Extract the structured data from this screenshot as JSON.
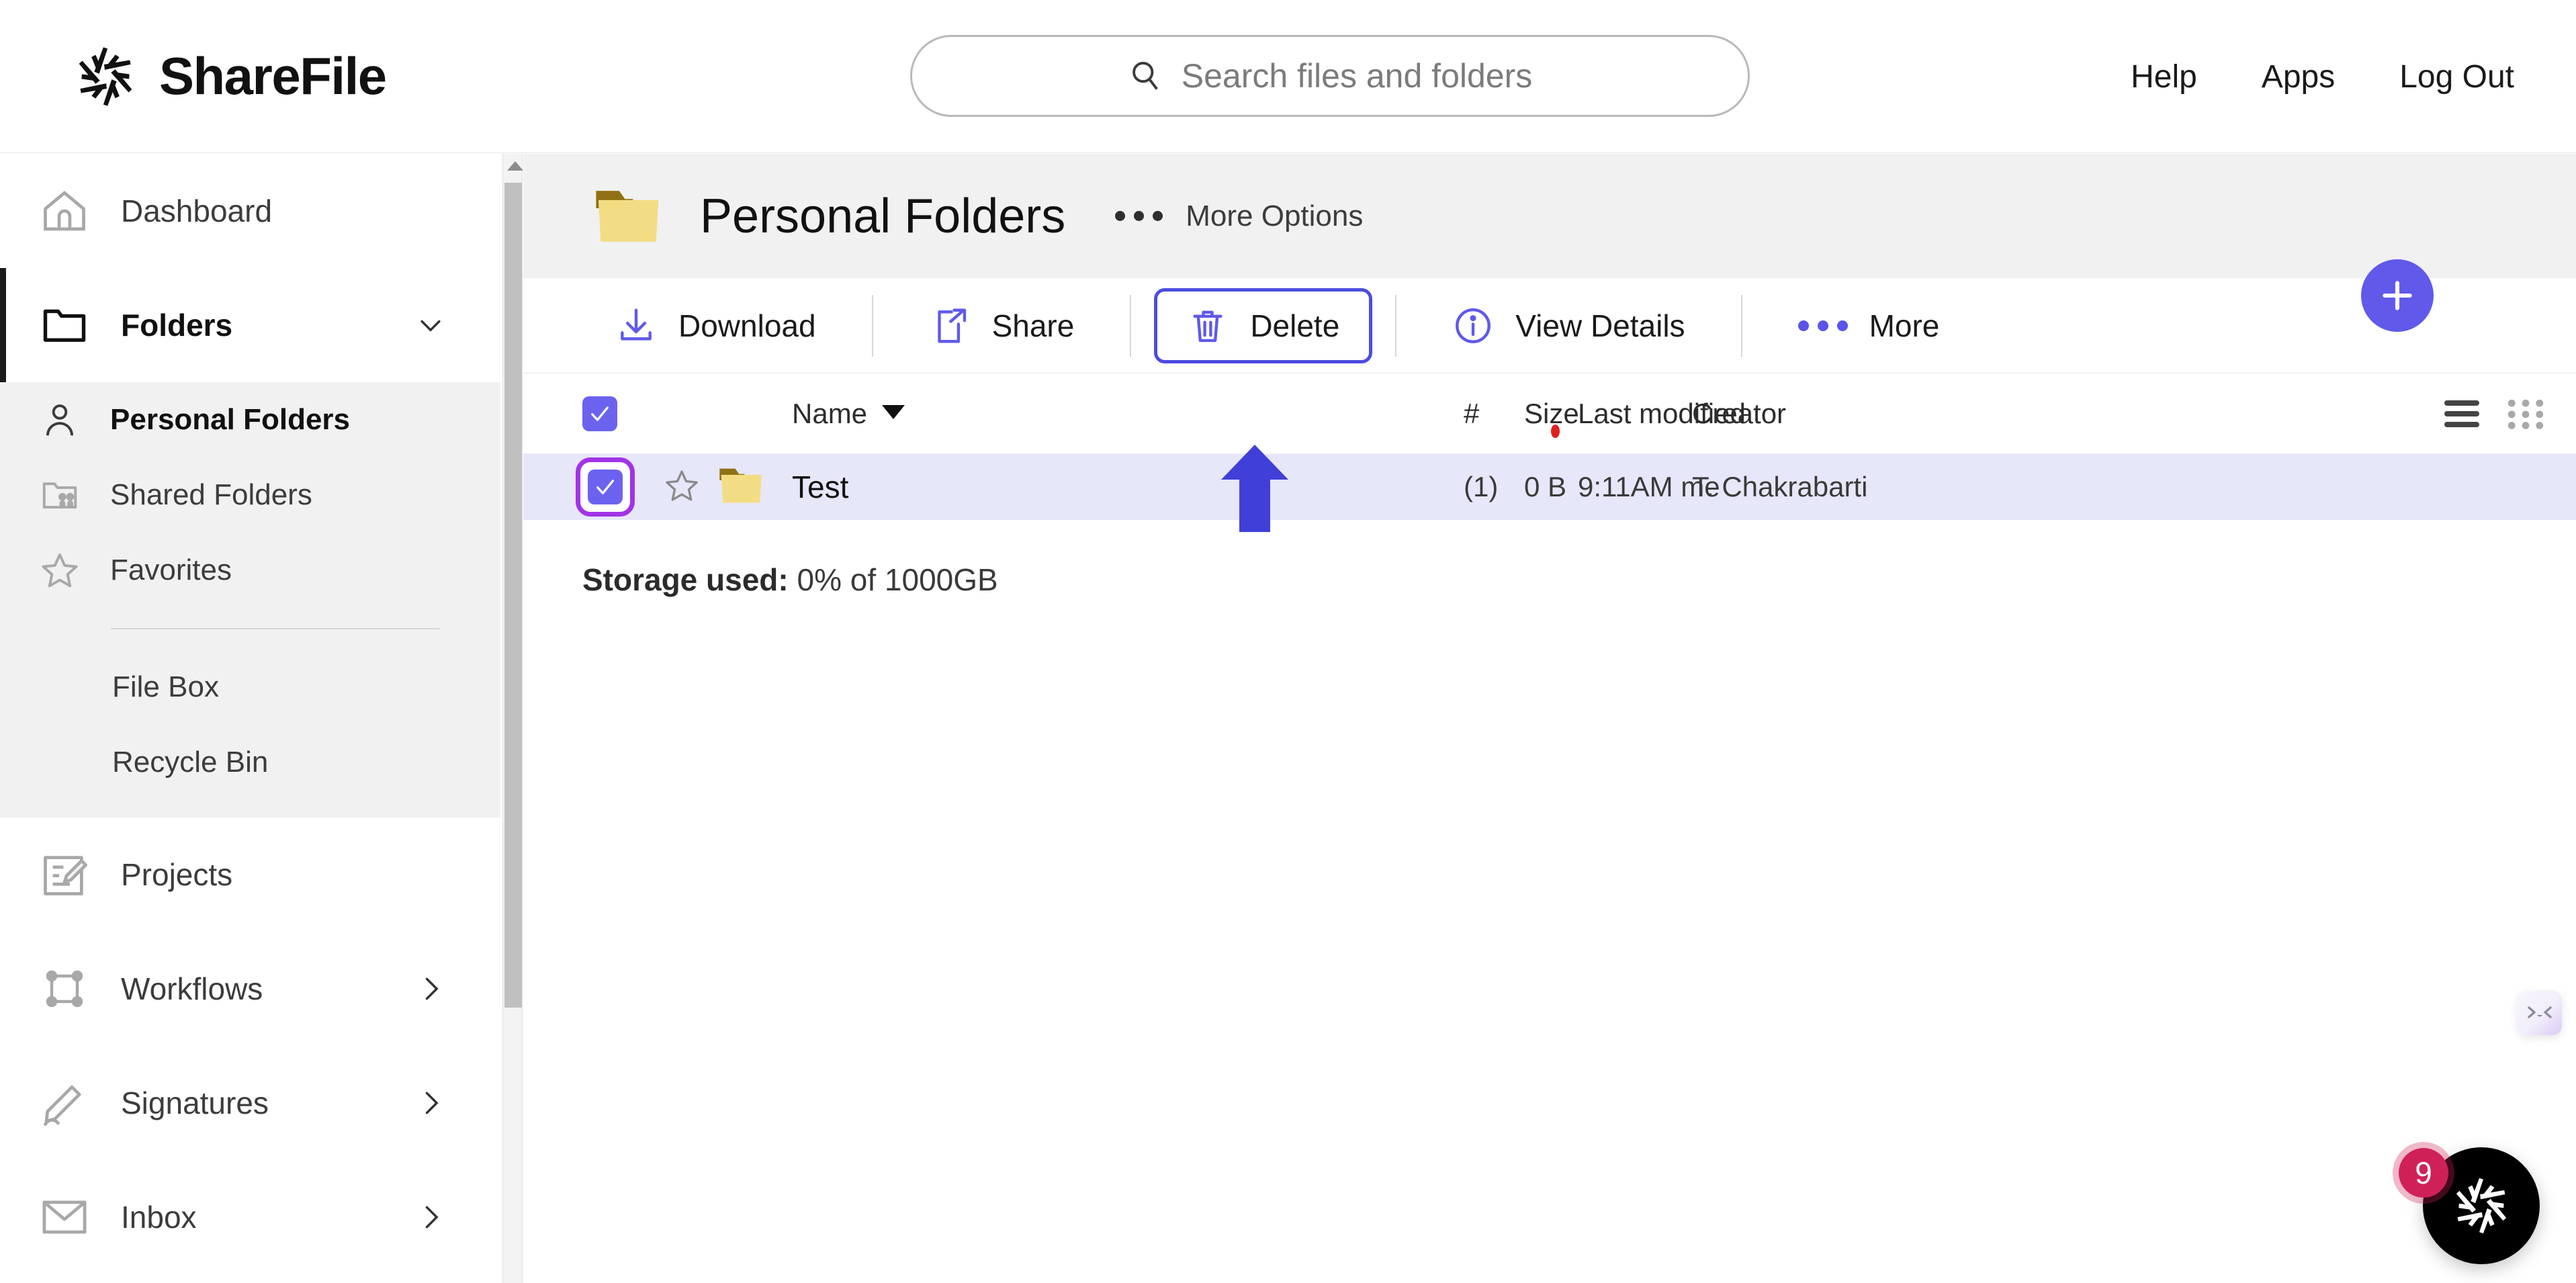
{
  "brand": {
    "name": "ShareFile",
    "logo_icon": "sharefile-logo-icon"
  },
  "search": {
    "placeholder": "Search files and folders",
    "value": "",
    "icon": "search-icon"
  },
  "topnav": [
    {
      "label": "Help"
    },
    {
      "label": "Apps"
    },
    {
      "label": "Log Out"
    }
  ],
  "sidebar": {
    "items": [
      {
        "label": "Dashboard",
        "icon": "home-icon"
      },
      {
        "label": "Folders",
        "icon": "folder-icon",
        "chevron": "chevron-down-icon",
        "active": true
      },
      {
        "label": "Projects",
        "icon": "projects-icon"
      },
      {
        "label": "Workflows",
        "icon": "workflows-icon",
        "chevron": "chevron-right-icon"
      },
      {
        "label": "Signatures",
        "icon": "signature-pen-icon",
        "chevron": "chevron-right-icon"
      },
      {
        "label": "Inbox",
        "icon": "envelope-icon",
        "chevron": "chevron-right-icon"
      }
    ],
    "subitems": [
      {
        "label": "Personal Folders",
        "icon": "person-icon",
        "current": true
      },
      {
        "label": "Shared Folders",
        "icon": "shared-folder-icon"
      },
      {
        "label": "Favorites",
        "icon": "star-icon"
      }
    ],
    "subitems_plain": [
      {
        "label": "File Box"
      },
      {
        "label": "Recycle Bin"
      }
    ]
  },
  "page": {
    "title": "Personal Folders",
    "folder_icon": "folder-icon",
    "more_options_label": "More Options",
    "more_options_icon": "ellipsis-icon"
  },
  "toolbar": {
    "download_label": "Download",
    "download_icon": "download-icon",
    "share_label": "Share",
    "share_icon": "share-icon",
    "delete_label": "Delete",
    "delete_icon": "trash-icon",
    "view_details_label": "View Details",
    "view_details_icon": "info-circle-icon",
    "more_label": "More",
    "more_icon": "ellipsis-icon",
    "focused_button": "Delete"
  },
  "table": {
    "select_all_checked": true,
    "sort_column": "Name",
    "sort_direction": "desc",
    "columns": {
      "name": "Name",
      "count": "#",
      "size": "Size",
      "last_modified": "Last modified",
      "creator": "Creator"
    },
    "rows": [
      {
        "checked": true,
        "favorite": false,
        "icon": "folder-icon",
        "name": "Test",
        "count": "(1)",
        "size": "0 B",
        "last_modified": "9:11AM  me",
        "creator": "T. Chakrabarti"
      }
    ],
    "view_list_icon": "list-view-icon",
    "view_grid_icon": "grid-view-icon",
    "active_view": "list"
  },
  "storage": {
    "label": "Storage used:",
    "value": "0% of 1000GB"
  },
  "fab": {
    "icon": "plus-icon"
  },
  "support_widget": {
    "icon": "sharefile-logo-icon",
    "badge_count": "9"
  },
  "kawaii_widget": {
    "icon": "kawaii-face-icon"
  },
  "annotation": {
    "icon": "up-arrow-annotation",
    "points_at": "Delete"
  },
  "colors": {
    "accent": "#6059ea",
    "focus_outline": "#4c4ce0",
    "checkbox_focus": "#a233e6",
    "row_selected_bg": "#e7e7fa",
    "badge": "#cf2158",
    "alert_dot": "#e02020",
    "folder_body": "#f3dd84",
    "folder_tab": "#8f7012"
  }
}
